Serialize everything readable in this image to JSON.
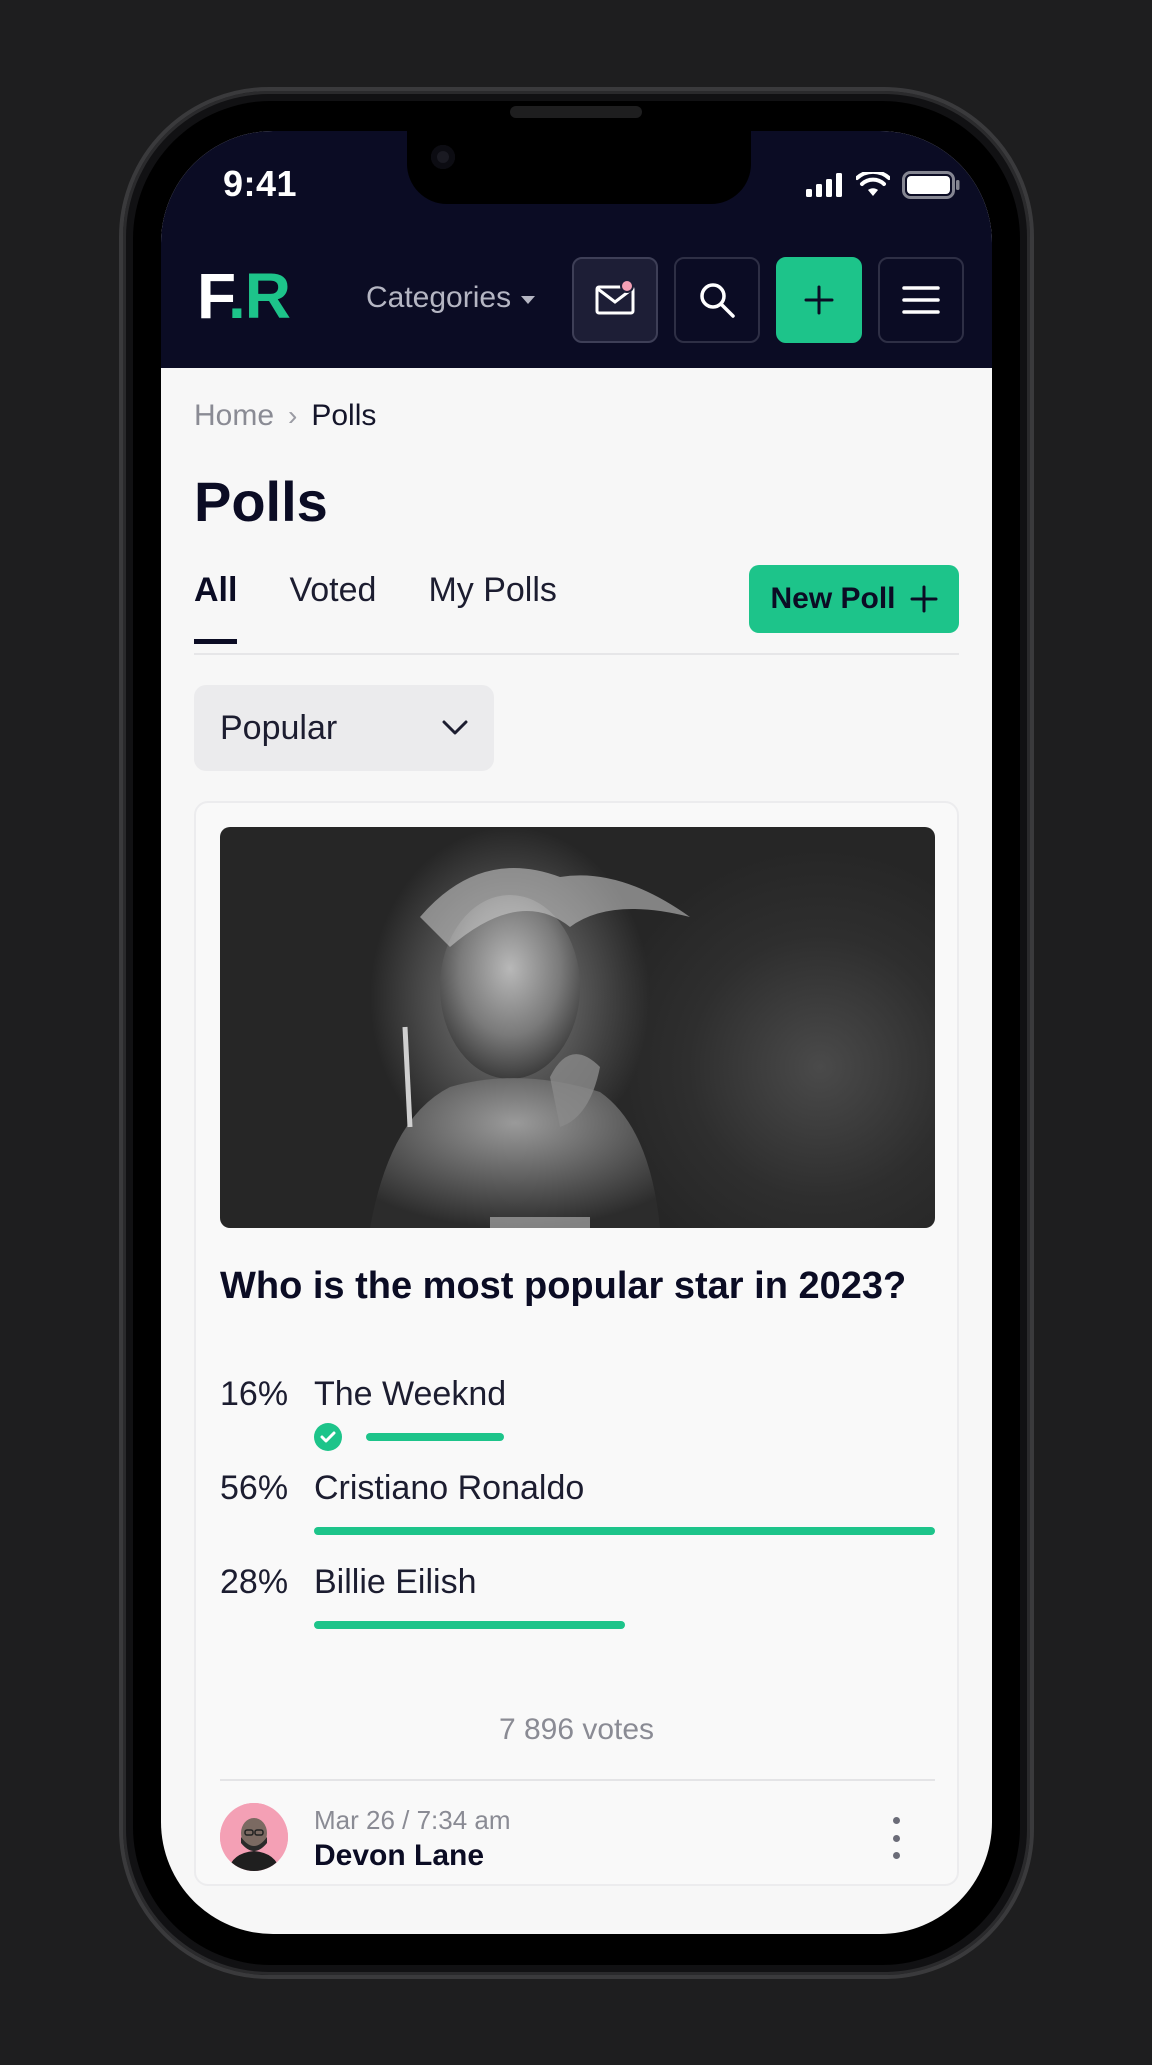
{
  "status_bar": {
    "time": "9:41"
  },
  "header": {
    "logo_letter_1": "F",
    "logo_dot": ".",
    "logo_letter_2": "R",
    "categories_label": "Categories"
  },
  "breadcrumb": {
    "home": "Home",
    "separator": "›",
    "current": "Polls"
  },
  "page": {
    "title": "Polls"
  },
  "tabs": [
    {
      "label": "All",
      "active": true
    },
    {
      "label": "Voted",
      "active": false
    },
    {
      "label": "My Polls",
      "active": false
    }
  ],
  "new_poll_button": {
    "label": "New Poll"
  },
  "sort": {
    "selected": "Popular"
  },
  "poll": {
    "question": "Who is the most popular star in 2023?",
    "options": [
      {
        "percent_label": "16%",
        "name": "The Weeknd",
        "fraction": 0.16,
        "voted": true
      },
      {
        "percent_label": "56%",
        "name": "Cristiano Ronaldo",
        "fraction": 0.56,
        "voted": false
      },
      {
        "percent_label": "28%",
        "name": "Billie Eilish",
        "fraction": 0.28,
        "voted": false
      }
    ],
    "votes_label": "7 896 votes",
    "author": {
      "date": "Mar 26 / 7:34 am",
      "name": "Devon Lane"
    }
  },
  "colors": {
    "accent": "#1dc48a",
    "header_bg": "#0b0c24",
    "notification_dot": "#f4a0b5"
  },
  "icons": [
    "signal-icon",
    "wifi-icon",
    "battery-icon",
    "mail-icon",
    "search-icon",
    "plus-icon",
    "hamburger-icon",
    "chevron-down-icon",
    "check-icon",
    "more-vertical-icon"
  ]
}
